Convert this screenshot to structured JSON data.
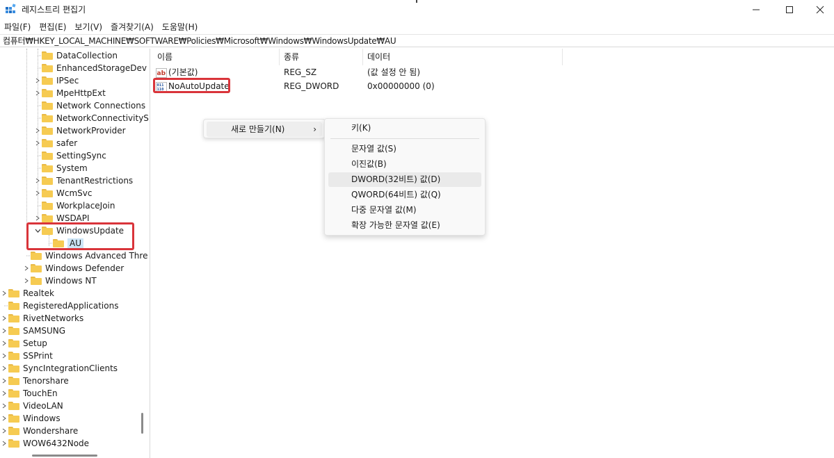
{
  "window": {
    "title": "레지스트리 편집기",
    "minimize_glyph": "—",
    "maximize_glyph": "☐",
    "close_glyph": "✕"
  },
  "menu": [
    "파일(F)",
    "편집(E)",
    "보기(V)",
    "즐겨찾기(A)",
    "도움말(H)"
  ],
  "address": "컴퓨터₩HKEY_LOCAL_MACHINE₩SOFTWARE₩Policies₩Microsoft₩Windows₩WindowsUpdate₩AU",
  "tree": {
    "items": [
      {
        "label": "DataCollection",
        "level": 3,
        "expander": ""
      },
      {
        "label": "EnhancedStorageDev",
        "level": 3,
        "expander": ""
      },
      {
        "label": "IPSec",
        "level": 3,
        "expander": ">"
      },
      {
        "label": "MpeHttpExt",
        "level": 3,
        "expander": ">"
      },
      {
        "label": "Network Connections",
        "level": 3,
        "expander": ""
      },
      {
        "label": "NetworkConnectivityS",
        "level": 3,
        "expander": ""
      },
      {
        "label": "NetworkProvider",
        "level": 3,
        "expander": ">"
      },
      {
        "label": "safer",
        "level": 3,
        "expander": ">"
      },
      {
        "label": "SettingSync",
        "level": 3,
        "expander": ""
      },
      {
        "label": "System",
        "level": 3,
        "expander": ""
      },
      {
        "label": "TenantRestrictions",
        "level": 3,
        "expander": ">"
      },
      {
        "label": "WcmSvc",
        "level": 3,
        "expander": ">"
      },
      {
        "label": "WorkplaceJoin",
        "level": 3,
        "expander": ""
      },
      {
        "label": "WSDAPI",
        "level": 3,
        "expander": ">"
      },
      {
        "label": "WindowsUpdate",
        "level": 3,
        "expander": "v"
      },
      {
        "label": "AU",
        "level": 4,
        "expander": ""
      },
      {
        "label": "Windows Advanced Thre",
        "level": 2,
        "expander": ""
      },
      {
        "label": "Windows Defender",
        "level": 2,
        "expander": ">"
      },
      {
        "label": "Windows NT",
        "level": 2,
        "expander": ">"
      },
      {
        "label": "Realtek",
        "level": 0,
        "expander": ">"
      },
      {
        "label": "RegisteredApplications",
        "level": 0,
        "expander": ""
      },
      {
        "label": "RivetNetworks",
        "level": 0,
        "expander": ">"
      },
      {
        "label": "SAMSUNG",
        "level": 0,
        "expander": ">"
      },
      {
        "label": "Setup",
        "level": 0,
        "expander": ">"
      },
      {
        "label": "SSPrint",
        "level": 0,
        "expander": ">"
      },
      {
        "label": "SyncIntegrationClients",
        "level": 0,
        "expander": ">"
      },
      {
        "label": "Tenorshare",
        "level": 0,
        "expander": ">"
      },
      {
        "label": "TouchEn",
        "level": 0,
        "expander": ">"
      },
      {
        "label": "VideoLAN",
        "level": 0,
        "expander": ">"
      },
      {
        "label": "Windows",
        "level": 0,
        "expander": ">"
      },
      {
        "label": "Wondershare",
        "level": 0,
        "expander": ">"
      },
      {
        "label": "WOW6432Node",
        "level": 0,
        "expander": ">"
      }
    ]
  },
  "list": {
    "columns": [
      "이름",
      "종류",
      "데이터"
    ],
    "rows": [
      {
        "icon": "string-value-icon",
        "icon_text": "ab",
        "name": "(기본값)",
        "type": "REG_SZ",
        "data": "(값 설정 안 됨)"
      },
      {
        "icon": "binary-value-icon",
        "icon_text": "011 110",
        "name": "NoAutoUpdate",
        "type": "REG_DWORD",
        "data": "0x00000000 (0)"
      }
    ]
  },
  "context_menu": {
    "new_label": "새로 만들기(N)",
    "arrow": "›",
    "submenu": {
      "key": "키(K)",
      "items": [
        "문자열 값(S)",
        "이진값(B)",
        "DWORD(32비트) 값(D)",
        "QWORD(64비트) 값(Q)",
        "다중 문자열 값(M)",
        "확장 가능한 문자열 값(E)"
      ],
      "hovered": "DWORD(32비트) 값(D)"
    }
  },
  "colors": {
    "highlight_box": "#d9343a",
    "folder": "#f6cb52",
    "selection": "#cde6f7"
  }
}
